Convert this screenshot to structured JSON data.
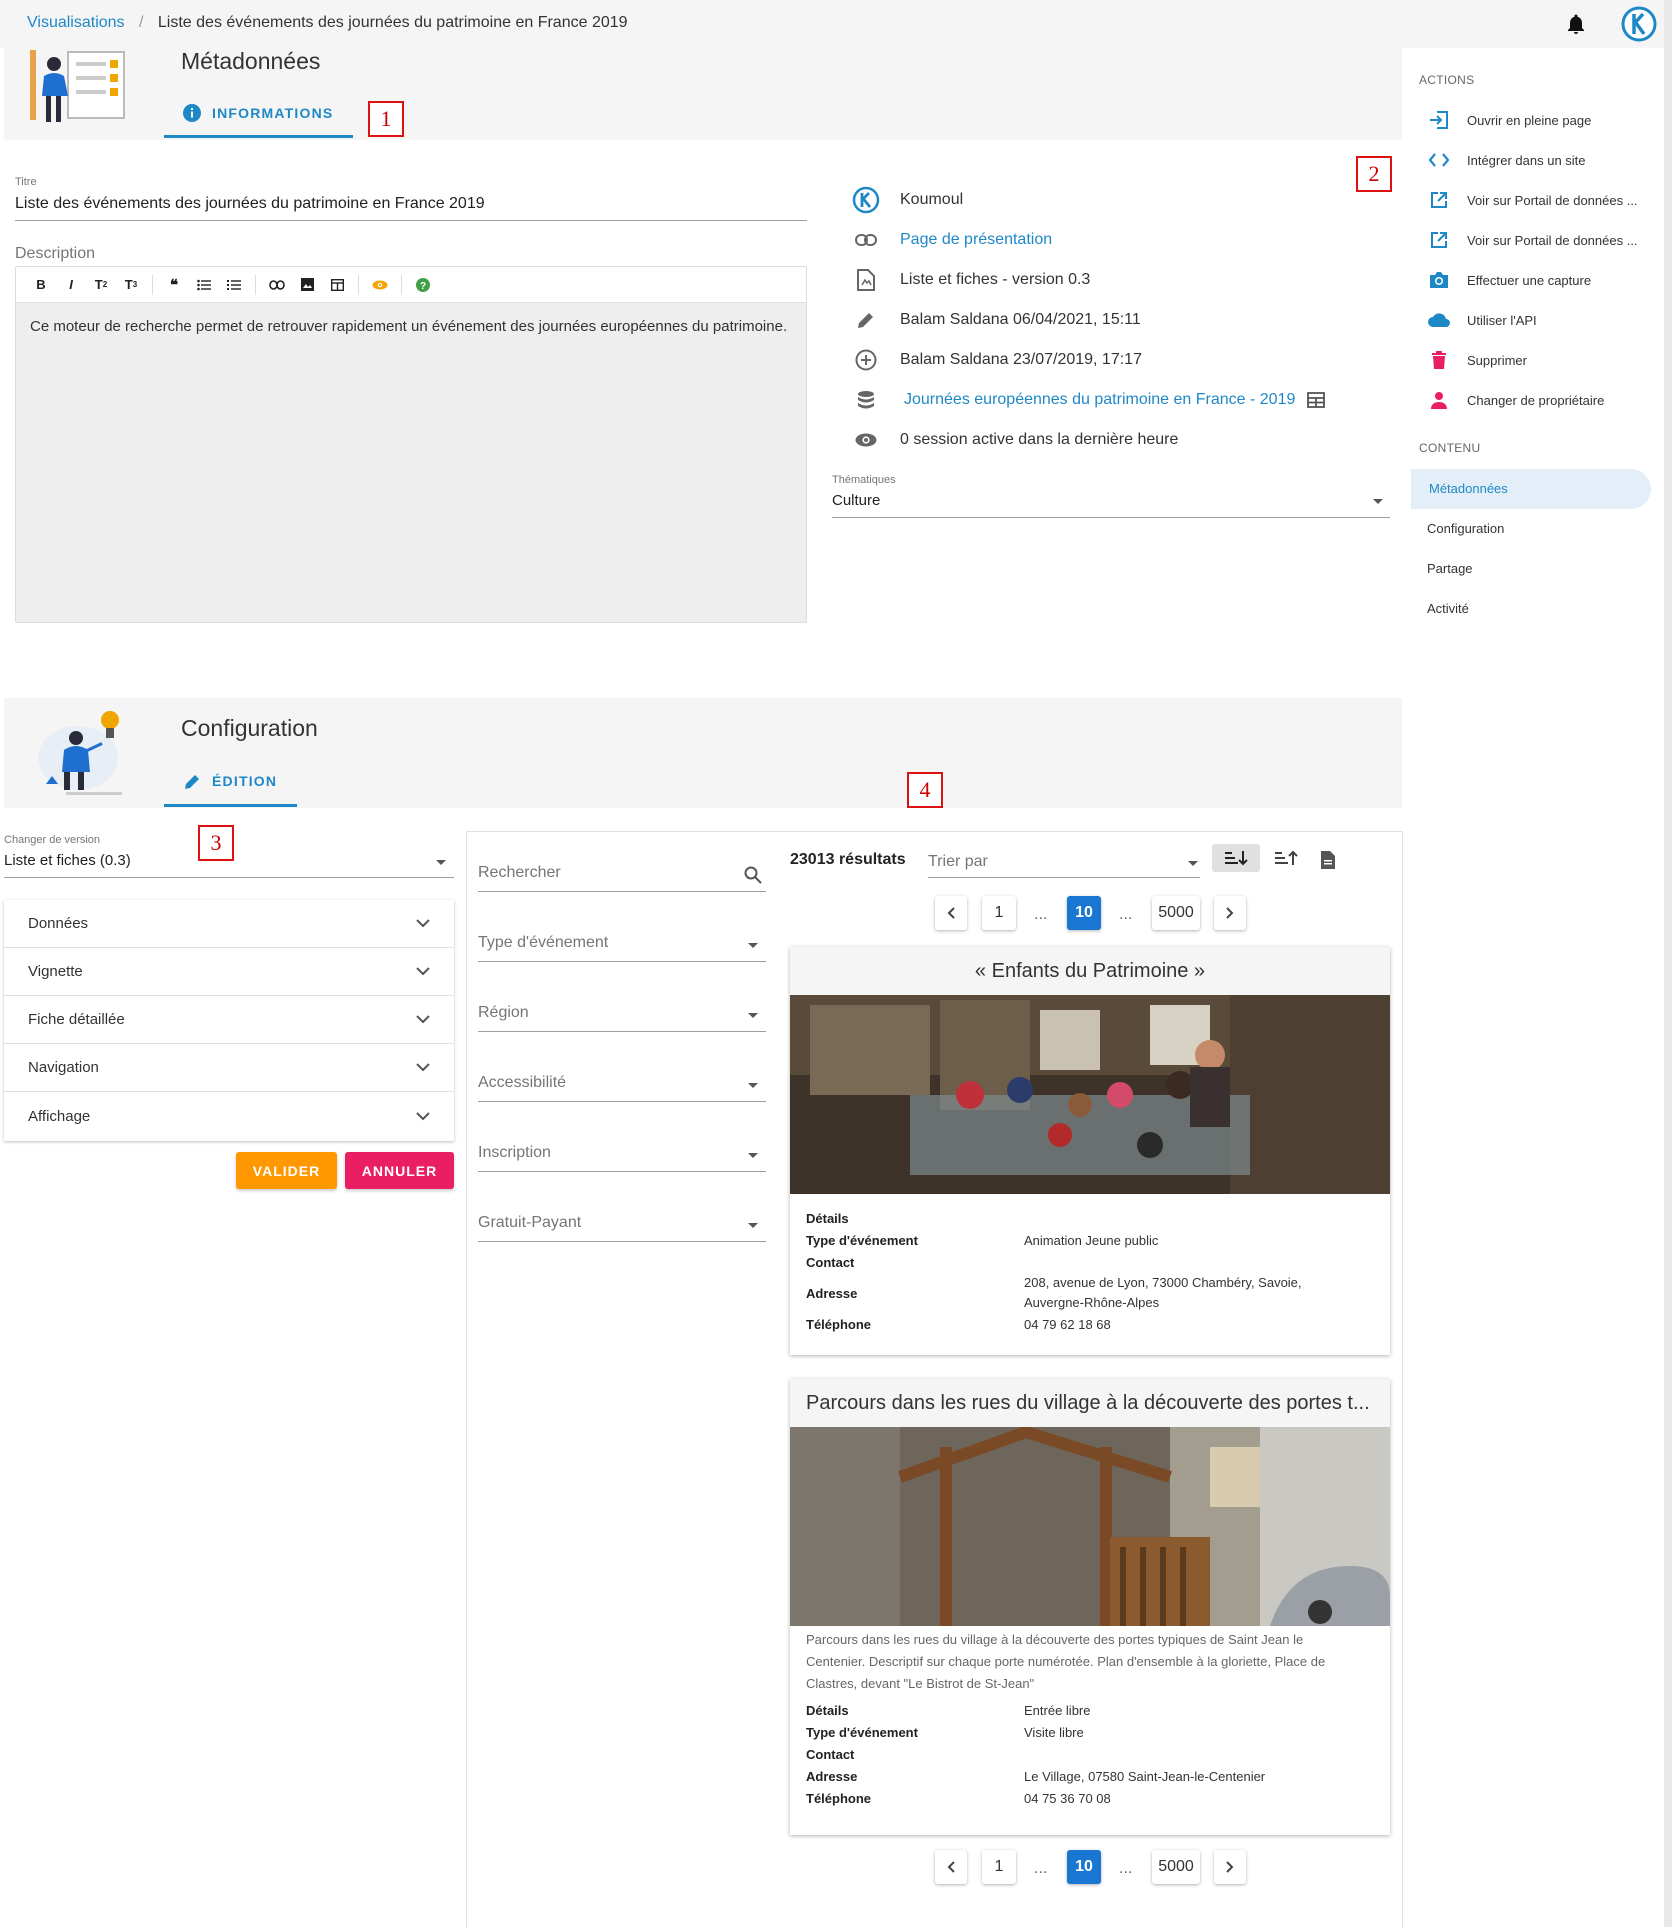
{
  "breadcrumb": {
    "root": "Visualisations",
    "separator": "/",
    "current": "Liste des événements des journées du patrimoine en France 2019"
  },
  "metadata": {
    "title": "Métadonnées",
    "tab_label": "INFORMATIONS",
    "titre_label": "Titre",
    "titre_value": "Liste des événements des journées du patrimoine en France 2019",
    "description_label": "Description",
    "description_text": "Ce moteur de recherche permet de retrouver rapidement un événement des journées européennes du patrimoine.",
    "toolbar": [
      "B",
      "I",
      "T2",
      "T3",
      "quote",
      "bullet-list",
      "numbered-list",
      "link",
      "image",
      "table",
      "preview",
      "help"
    ],
    "info": {
      "owner": "Koumoul",
      "presentation_link": "Page de présentation",
      "app": "Liste et fiches - version 0.3",
      "updated": "Balam Saldana 06/04/2021, 15:11",
      "created": "Balam Saldana 23/07/2019, 17:17",
      "dataset": "Journées européennes du patrimoine en France - 2019",
      "sessions": "0 session active dans la dernière heure"
    },
    "thematiques_label": "Thématiques",
    "thematiques_value": "Culture"
  },
  "annotations": {
    "a1": "1",
    "a2": "2",
    "a3": "3",
    "a4": "4"
  },
  "sidebar": {
    "actions_title": "ACTIONS",
    "actions": [
      {
        "label": "Ouvrir en pleine page",
        "icon": "open-full-page-icon"
      },
      {
        "label": "Intégrer dans un site",
        "icon": "code-icon"
      },
      {
        "label": "Voir sur Portail de données ...",
        "icon": "external-link-icon"
      },
      {
        "label": "Voir sur Portail de données ...",
        "icon": "external-link-icon"
      },
      {
        "label": "Effectuer une capture",
        "icon": "camera-icon"
      },
      {
        "label": "Utiliser l'API",
        "icon": "cloud-icon"
      },
      {
        "label": "Supprimer",
        "icon": "trash-icon"
      },
      {
        "label": "Changer de propriétaire",
        "icon": "person-icon"
      }
    ],
    "content_title": "CONTENU",
    "content": [
      "Métadonnées",
      "Configuration",
      "Partage",
      "Activité"
    ]
  },
  "configuration": {
    "title": "Configuration",
    "tab_label": "ÉDITION",
    "version_label": "Changer de version",
    "version_value": "Liste et fiches (0.3)",
    "accordions": [
      "Données",
      "Vignette",
      "Fiche détaillée",
      "Navigation",
      "Affichage"
    ],
    "validate": "VALIDER",
    "cancel": "ANNULER"
  },
  "preview": {
    "search_placeholder": "Rechercher",
    "filters": [
      "Type d'événement",
      "Région",
      "Accessibilité",
      "Inscription",
      "Gratuit-Payant"
    ],
    "results": "23013 résultats",
    "sort_placeholder": "Trier par",
    "pagination": {
      "first": "1",
      "ellipsis": "...",
      "current": "10",
      "last": "5000"
    },
    "cards": [
      {
        "title": "« Enfants du Patrimoine »",
        "details_label": "Détails",
        "details_value": "",
        "type_label": "Type d'événement",
        "type_value": "Animation Jeune public",
        "contact_label": "Contact",
        "address_label": "Adresse",
        "address_line1": "208, avenue de Lyon, 73000 Chambéry, Savoie,",
        "address_line2": "Auvergne-Rhône-Alpes",
        "phone_label": "Téléphone",
        "phone_value": "04 79 62 18 68"
      },
      {
        "title": "Parcours dans les rues du village à la découverte des portes t...",
        "description_line1": "Parcours dans les rues du village à la découverte des portes typiques de Saint Jean le",
        "description_line2": "Centenier. Descriptif sur chaque porte numérotée. Plan d'ensemble à la gloriette, Place de",
        "description_line3": "Clastres, devant \"Le Bistrot de St-Jean\"",
        "details_label": "Détails",
        "details_value": "Entrée libre",
        "type_label": "Type d'événement",
        "type_value": "Visite libre",
        "contact_label": "Contact",
        "address_label": "Adresse",
        "address_value": "Le Village, 07580 Saint-Jean-le-Centenier",
        "phone_label": "Téléphone",
        "phone_value": "04 75 36 70 08"
      }
    ]
  }
}
